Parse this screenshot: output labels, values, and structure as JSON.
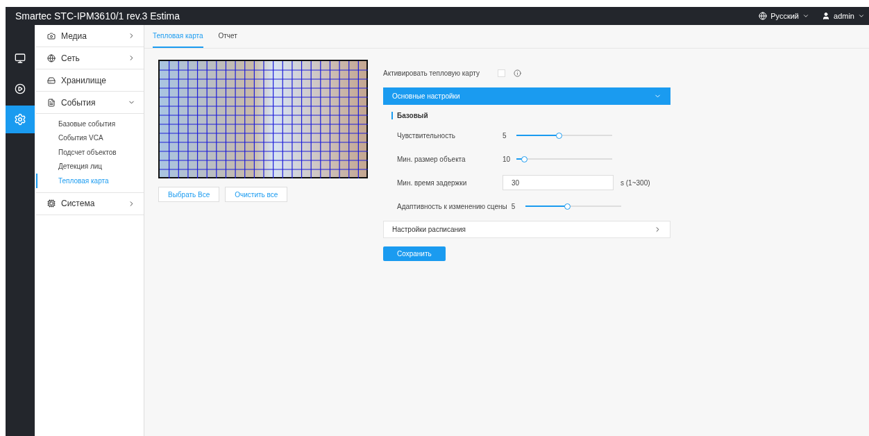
{
  "header": {
    "title": "Smartec STC-IPM3610/1 rev.3 Estima",
    "language": "Русский",
    "user": "admin"
  },
  "rail": [
    {
      "kind": "monitor",
      "selected": false
    },
    {
      "kind": "play",
      "selected": false
    },
    {
      "kind": "gears",
      "selected": true
    }
  ],
  "menu": [
    {
      "kind": "camera",
      "label": "Медиа",
      "expanded": false
    },
    {
      "kind": "globe",
      "label": "Сеть",
      "expanded": false
    },
    {
      "kind": "storage",
      "label": "Хранилище"
    },
    {
      "kind": "events",
      "label": "События",
      "expanded": true,
      "children": [
        {
          "label": "Базовые события",
          "selected": false
        },
        {
          "label": "События VCA",
          "selected": false
        },
        {
          "label": "Подсчет объектов",
          "selected": false
        },
        {
          "label": "Детекция лиц",
          "selected": false
        },
        {
          "label": "Тепловая карта",
          "selected": true
        }
      ]
    },
    {
      "kind": "system",
      "label": "Система",
      "expanded": false
    }
  ],
  "tabs": [
    {
      "label": "Тепловая карта",
      "selected": true
    },
    {
      "label": "Отчет",
      "selected": false
    }
  ],
  "preview_buttons": [
    "Выбрать Все",
    "Очистить все"
  ],
  "enable": {
    "label": "Активировать тепловую карту",
    "checked": false
  },
  "basic_panel": {
    "title": "Основные настройки",
    "expanded": true,
    "section": "Базовый",
    "rows": [
      {
        "kind": "slider",
        "label": "Чувствительность",
        "reading": "5",
        "level": 0.44
      },
      {
        "kind": "slider",
        "label": "Мин. размер объекта",
        "reading": "10",
        "level": 0.08
      },
      {
        "kind": "input",
        "label": "Мин. время задержки",
        "value": "30",
        "unit": "s (1~300)"
      },
      {
        "kind": "slider",
        "label": "Адаптивность к изменению сцены",
        "reading": "5",
        "level": 0.44
      }
    ]
  },
  "schedule_panel": {
    "title": "Настройки расписания",
    "expanded": false
  },
  "save_button": "Сохранить"
}
